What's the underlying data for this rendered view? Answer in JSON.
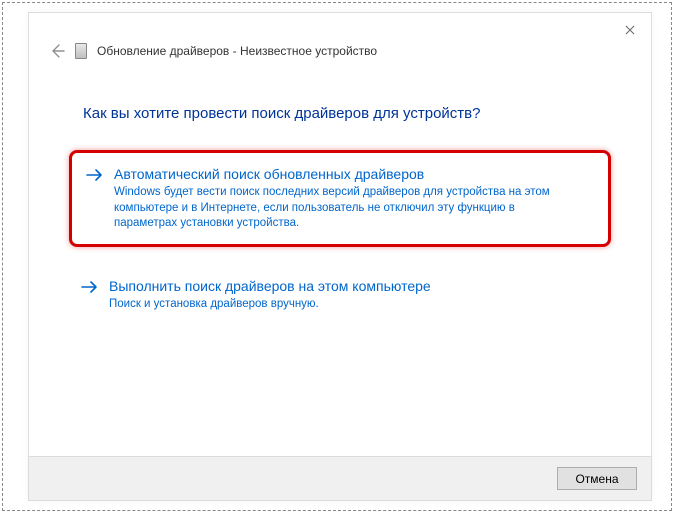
{
  "header": {
    "title": "Обновление драйверов - Неизвестное устройство"
  },
  "main": {
    "heading": "Как вы хотите провести поиск драйверов для устройств?"
  },
  "options": {
    "auto": {
      "title": "Автоматический поиск обновленных драйверов",
      "desc": "Windows будет вести поиск последних версий драйверов для устройства на этом компьютере и в Интернете, если пользователь не отключил эту функцию в параметрах установки устройства."
    },
    "manual": {
      "title": "Выполнить поиск драйверов на этом компьютере",
      "desc": "Поиск и установка драйверов вручную."
    }
  },
  "footer": {
    "cancel": "Отмена"
  }
}
